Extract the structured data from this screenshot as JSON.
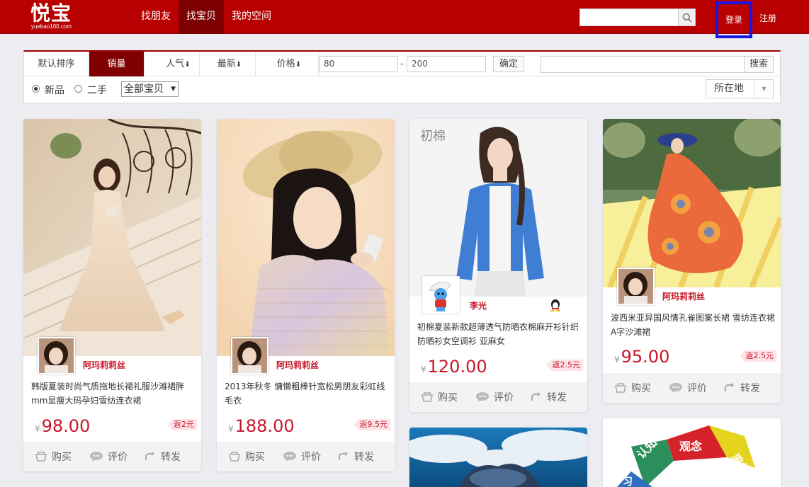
{
  "logo": {
    "name": "悦宝",
    "subtitle": "yuebao100.com"
  },
  "nav": {
    "items": [
      "找朋友",
      "找宝贝",
      "我的空间"
    ],
    "active_index": 1
  },
  "search": {
    "value": "",
    "placeholder": ""
  },
  "auth": {
    "login": "登录",
    "register": "注册"
  },
  "filter": {
    "sort_tabs": [
      {
        "label": "默认排序"
      },
      {
        "label": "销量",
        "active": true
      },
      {
        "label": "人气"
      },
      {
        "label": "最新"
      },
      {
        "label": "价格"
      }
    ],
    "sort_arrow": "⬇",
    "price_min": "80",
    "price_dash": "-",
    "price_max": "200",
    "confirm": "确定",
    "keyword_value": "",
    "search_btn": "搜索",
    "radios": [
      {
        "label": "新品",
        "checked": true
      },
      {
        "label": "二手",
        "checked": false
      }
    ],
    "category": "全部宝贝",
    "location": "所在地"
  },
  "cards": [
    {
      "author": "阿玛莉莉丝",
      "title": "韩版夏装时尚气质拖地长裙礼服沙滩裙胖mm显瘦大码孕妇雪纺连衣裙",
      "currency": "¥",
      "price": "98.00",
      "rebate": "返2元",
      "actions": [
        "购买",
        "评价",
        "转发"
      ]
    },
    {
      "author": "阿玛莉莉丝",
      "title": "2013年秋冬 慵懒粗棒针宽松男朋友彩虹线毛衣",
      "currency": "¥",
      "price": "188.00",
      "rebate": "返9.5元",
      "actions": [
        "购买",
        "评价",
        "转发"
      ]
    },
    {
      "author": "李光",
      "title": "初棉夏装新款超薄透气防晒衣棉麻开衫针织防晒衫女空调衫 亚麻女",
      "currency": "¥",
      "price": "120.00",
      "rebate": "返2.5元",
      "actions": [
        "购买",
        "评价",
        "转发"
      ],
      "brand_watermark": "初棉",
      "has_qq": true
    },
    {
      "author": "阿玛莉莉丝",
      "title": "波西米亚异国风情孔雀图案长裙 雪纺连衣裙A字沙滩裙",
      "currency": "¥",
      "price": "95.00",
      "rebate": "返2.5元",
      "actions": [
        "购买",
        "评价",
        "转发"
      ]
    }
  ],
  "bottom_cards": [
    {
      "image": "sky-clouds-heart"
    },
    {
      "words": [
        "认知",
        "观念",
        "思想",
        "习"
      ]
    }
  ],
  "colors": {
    "header": "#b80000",
    "active_nav": "#7d0000",
    "active_sort": "#7f0000",
    "price": "#c8172a",
    "author": "#c8182b",
    "login_highlight": "#1616e8"
  }
}
